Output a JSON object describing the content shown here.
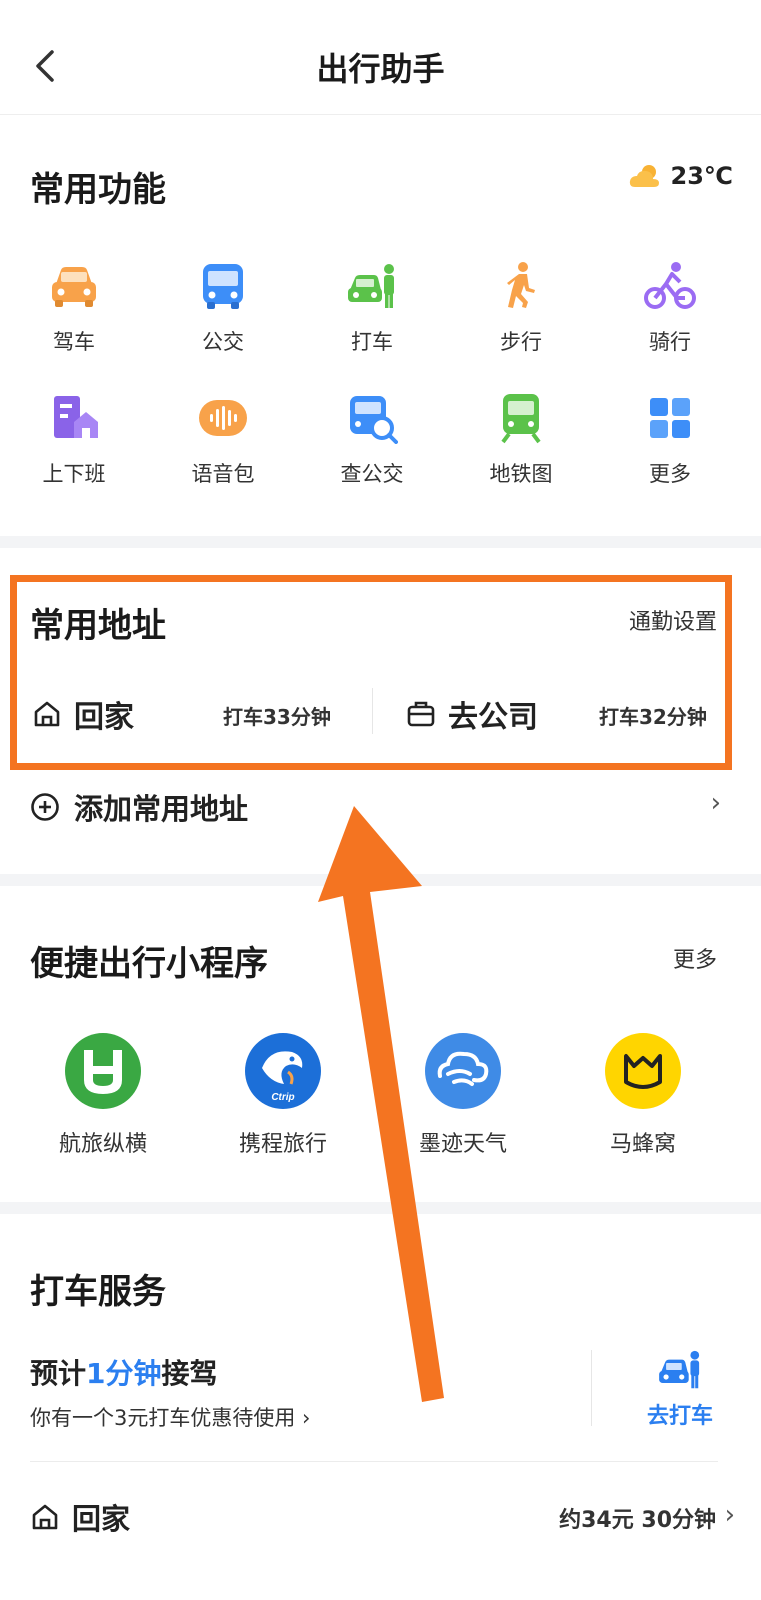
{
  "header": {
    "title": "出行助手",
    "back_icon": "chevron-left-icon"
  },
  "common_functions": {
    "title": "常用功能",
    "weather": {
      "icon": "partly-cloudy-icon",
      "temp": "23℃"
    },
    "items": [
      {
        "label": "驾车",
        "icon": "car-icon",
        "color": "#f8a24a"
      },
      {
        "label": "公交",
        "icon": "bus-icon",
        "color": "#3d8ef8"
      },
      {
        "label": "打车",
        "icon": "taxi-icon",
        "color": "#5bc24a"
      },
      {
        "label": "步行",
        "icon": "walk-icon",
        "color": "#f8a24a"
      },
      {
        "label": "骑行",
        "icon": "bike-icon",
        "color": "#9b6cf3"
      },
      {
        "label": "上下班",
        "icon": "commute-icon",
        "color": "#8a63e8"
      },
      {
        "label": "语音包",
        "icon": "voice-icon",
        "color": "#f8a24a"
      },
      {
        "label": "查公交",
        "icon": "bus-search-icon",
        "color": "#3d8ef8"
      },
      {
        "label": "地铁图",
        "icon": "subway-icon",
        "color": "#5bc24a"
      },
      {
        "label": "更多",
        "icon": "grid-icon",
        "color": "#3d8ef8"
      }
    ]
  },
  "common_address": {
    "title": "常用地址",
    "settings_link": "通勤设置",
    "home": {
      "label": "回家",
      "eta": "打车33分钟"
    },
    "work": {
      "label": "去公司",
      "eta": "打车32分钟"
    },
    "add_label": "添加常用地址",
    "highlight_color": "#f47421"
  },
  "mini_programs": {
    "title": "便捷出行小程序",
    "more_label": "更多",
    "items": [
      {
        "label": "航旅纵横",
        "icon": "hanglv-logo-icon",
        "color": "#3aa843"
      },
      {
        "label": "携程旅行",
        "icon": "ctrip-dolphin-icon",
        "color": "#1c6fd8",
        "logo_text": "Ctrip"
      },
      {
        "label": "墨迹天气",
        "icon": "moji-cloud-icon",
        "color": "#3f8be6"
      },
      {
        "label": "马蜂窝",
        "icon": "mafengwo-icon",
        "color": "#ffd500"
      }
    ]
  },
  "taxi_service": {
    "title": "打车服务",
    "eta_prefix": "预计",
    "eta_value": "1分钟",
    "eta_suffix": "接驾",
    "coupon_text": "你有一个3元打车优惠待使用 ›",
    "go_label": "去打车",
    "home_label": "回家",
    "home_eta": "约34元 30分钟",
    "accent": "#2b7ff0"
  },
  "annotation": {
    "arrow_color": "#f47421"
  }
}
